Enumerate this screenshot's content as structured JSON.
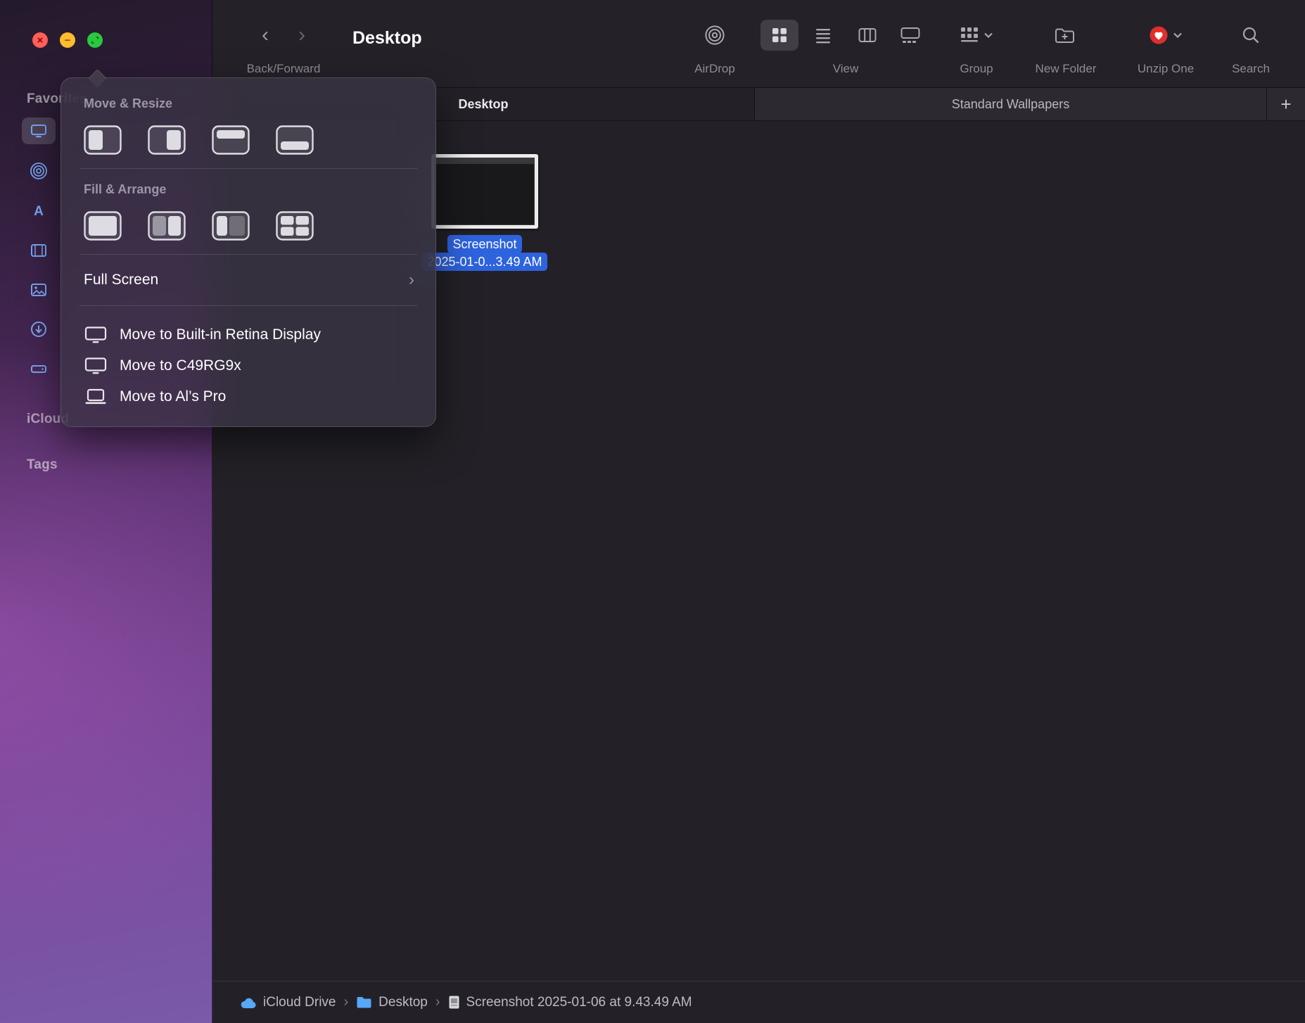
{
  "colors": {
    "selection_blue": "#2e63de",
    "unzip_red": "#e12d2d",
    "sidebar_icon_blue": "#79a7f7",
    "content_bg": "#232127"
  },
  "glyphs": {
    "back": "‹",
    "forward": "›",
    "chevron_right": "›",
    "path_sep": "›",
    "close": "×",
    "minimize": "−"
  },
  "toolbar": {
    "back_forward": "Back/Forward",
    "title": "Desktop",
    "airdrop": "AirDrop",
    "view": "View",
    "group": "Group",
    "new_folder": "New Folder",
    "unzip": "Unzip One",
    "search": "Search"
  },
  "tabs": {
    "desktop": "Desktop",
    "wallpapers": "Standard Wallpapers",
    "add": "+"
  },
  "sidebar": {
    "favorites": "Favorites",
    "icloud": "iCloud",
    "tags": "Tags"
  },
  "popover": {
    "move_resize": "Move & Resize",
    "fill_arrange": "Fill & Arrange",
    "full_screen": "Full Screen",
    "moves": [
      {
        "label": "Move to Built-in Retina Display"
      },
      {
        "label": "Move to C49RG9x"
      },
      {
        "label": "Move to Al’s Pro"
      }
    ]
  },
  "file": {
    "line1": "Screenshot",
    "line2": "2025-01-0...3.49 AM"
  },
  "pathbar": {
    "items": [
      {
        "label": "iCloud Drive"
      },
      {
        "label": "Desktop"
      },
      {
        "label": "Screenshot 2025-01-06 at 9.43.49 AM"
      }
    ]
  }
}
